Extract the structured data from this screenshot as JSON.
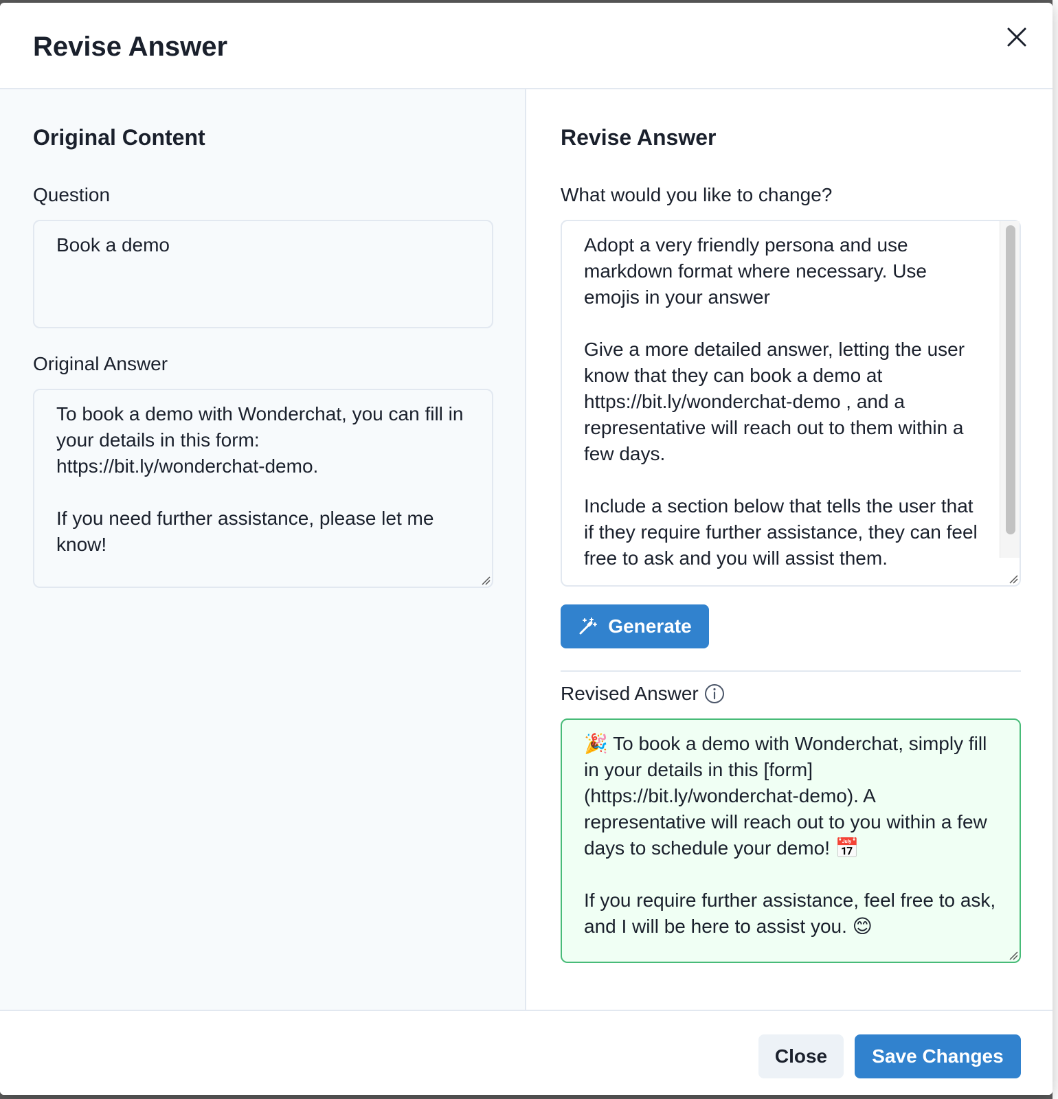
{
  "modal": {
    "title": "Revise Answer",
    "close_icon": "close-icon"
  },
  "left": {
    "heading": "Original Content",
    "question_label": "Question",
    "question_value": "Book a demo",
    "answer_label": "Original Answer",
    "answer_value": "To book a demo with Wonderchat, you can fill in your details in this form: https://bit.ly/wonderchat-demo.\n\nIf you need further assistance, please let me know!"
  },
  "right": {
    "heading": "Revise Answer",
    "change_label": "What would you like to change?",
    "change_value": "Adopt a very friendly persona and use markdown format where necessary. Use emojis in your answer\n\nGive a more detailed answer, letting the user know that they can book a demo at https://bit.ly/wonderchat-demo , and a representative will reach out to them within a few days.\n\nInclude a section below that tells the user that if they require further assistance, they can feel free to ask and you will assist them.",
    "generate_label": "Generate",
    "generate_icon": "magic-wand-icon",
    "revised_label": "Revised Answer",
    "revised_info_icon": "info-icon",
    "revised_value": "🎉 To book a demo with Wonderchat, simply fill in your details in this [form](https://bit.ly/wonderchat-demo). A representative will reach out to you within a few days to schedule your demo! 📅\n\nIf you require further assistance, feel free to ask, and I will be here to assist you. 😊"
  },
  "footer": {
    "close_label": "Close",
    "save_label": "Save Changes"
  },
  "colors": {
    "primary": "#3182ce",
    "revised_border": "#48bb78",
    "revised_bg": "#f0fff4",
    "panel_bg": "#f7fafc"
  }
}
